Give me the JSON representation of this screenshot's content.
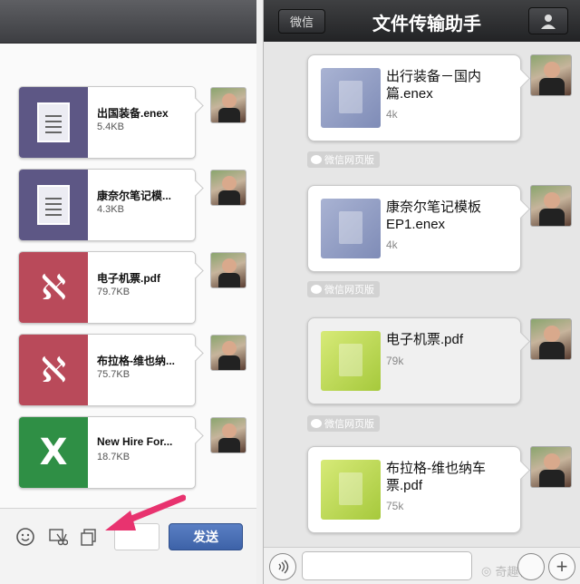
{
  "left_panel": {
    "files": [
      {
        "name": "出国装备.enex",
        "size": "5.4KB",
        "icon": "document-icon",
        "color": "#5d5785"
      },
      {
        "name": "康奈尔笔记模...",
        "size": "4.3KB",
        "icon": "document-icon",
        "color": "#5d5785"
      },
      {
        "name": "电子机票.pdf",
        "size": "79.7KB",
        "icon": "pdf-icon",
        "color": "#b94a5a"
      },
      {
        "name": "布拉格-维也纳...",
        "size": "75.7KB",
        "icon": "pdf-icon",
        "color": "#b94a5a"
      },
      {
        "name": "New Hire For...",
        "size": "18.7KB",
        "icon": "excel-icon",
        "color": "#2f8f45"
      }
    ],
    "toolbar": {
      "emoji_icon": "smiley-icon",
      "no_screenshot_icon": "scissors-icon",
      "copy_icon": "copy-icon",
      "send_label": "发送"
    }
  },
  "right_panel": {
    "back_label": "微信",
    "title": "文件传输助手",
    "profile_icon": "user-icon",
    "messages": [
      {
        "name": "出行装备－国内篇.enex",
        "size": "4k",
        "thumb": "blue"
      },
      {
        "name": "康奈尔笔记模板EP1.enex",
        "size": "4k",
        "thumb": "blue"
      },
      {
        "name": "电子机票.pdf",
        "size": "79k",
        "thumb": "lime"
      },
      {
        "name": "布拉格-维也纳车票.pdf",
        "size": "75k",
        "thumb": "lime"
      }
    ],
    "web_label": "微信网页版",
    "watermark": "奇趣化学"
  },
  "colors": {
    "send_button": "#3d62a8",
    "arrow": "#e8336f",
    "navbar": "#2a2b2d"
  }
}
